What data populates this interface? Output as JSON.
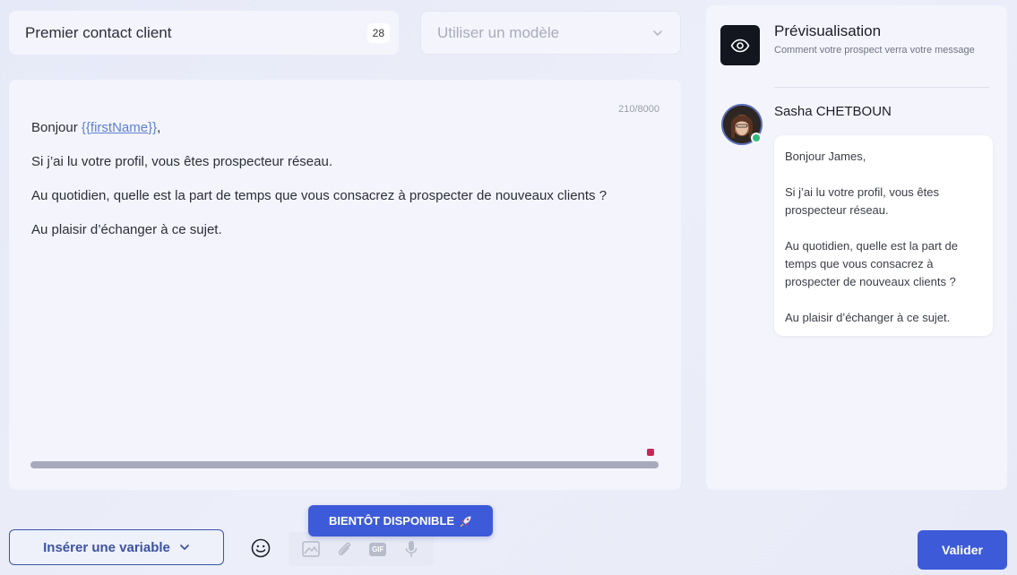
{
  "header": {
    "message_title": "Premier contact client",
    "title_counter": "28",
    "template_placeholder": "Utiliser un modèle"
  },
  "editor": {
    "char_count": "210/8000",
    "greeting_prefix": "Bonjour ",
    "var_open": "{{",
    "var_name": "firstName",
    "var_close": "}}",
    "greeting_suffix": ",",
    "line2": "Si j’ai lu votre profil, vous êtes prospecteur réseau.",
    "line3": "Au quotidien, quelle est la part de temps que vous consacrez à prospecter de nouveaux clients ?",
    "line4": "Au plaisir d’échanger à ce sujet."
  },
  "preview": {
    "title": "Prévisualisation",
    "subtitle": "Comment votre prospect verra votre message",
    "sender_name": "Sasha CHETBOUN",
    "bubble": {
      "p1": "Bonjour James,",
      "p2": "Si j’ai lu votre profil, vous êtes prospecteur réseau.",
      "p3": "Au quotidien, quelle est la part de temps que vous consacrez à prospecter de nouveaux clients ?",
      "p4": "Au plaisir d’échanger à ce sujet."
    }
  },
  "toolbar": {
    "insert_variable_label": "Insérer une variable",
    "coming_soon_label": "BIENTÔT DISPONIBLE",
    "gif_label": "GIF",
    "validate_label": "Valider"
  },
  "icons": {
    "eye": "eye-icon",
    "chevron": "chevron-down-icon",
    "emoji": "smiley-icon",
    "image": "image-icon",
    "attach": "paperclip-icon",
    "gif": "gif-icon",
    "mic": "microphone-icon",
    "rocket": "rocket-icon"
  },
  "colors": {
    "accent": "#3d5bd9",
    "variable": "#5c7fd6",
    "online": "#2ebc7a",
    "resize_marker": "#c52858"
  }
}
